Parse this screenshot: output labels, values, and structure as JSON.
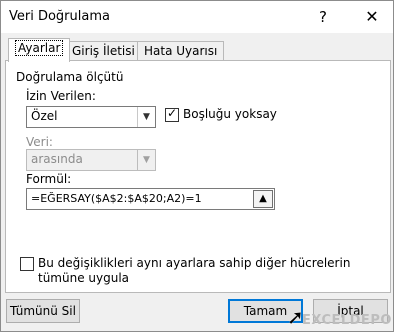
{
  "window": {
    "title": "Veri Doğrulama",
    "help_glyph": "?",
    "close_glyph": "✕"
  },
  "tabs": [
    {
      "label": "Ayarlar",
      "active": true
    },
    {
      "label": "Giriş İletisi",
      "active": false
    },
    {
      "label": "Hata Uyarısı",
      "active": false
    }
  ],
  "criteria": {
    "group_label": "Doğrulama ölçütü",
    "allow": {
      "label": "İzin Verilen:",
      "value": "Özel"
    },
    "ignore_blank": {
      "label": "Boşluğu yoksay",
      "checked": true
    },
    "data": {
      "label": "Veri:",
      "value": "arasında",
      "disabled": true
    },
    "formula": {
      "label": "Formül:",
      "value": "=EĞERSAY($A$2:$A$20;A2)=1"
    }
  },
  "apply_all": {
    "label": "Bu değişiklikleri aynı ayarlara sahip diğer hücrelerin tümüne uygula",
    "checked": false
  },
  "buttons": {
    "clear_all": "Tümünü Sil",
    "ok": "Tamam",
    "cancel": "İptal"
  },
  "watermark": "EXCELDEPO",
  "icons": {
    "ref": "collapse-dialog-icon",
    "dropdown": "chevron-down-icon",
    "cursor": "mouse-pointer-icon"
  }
}
